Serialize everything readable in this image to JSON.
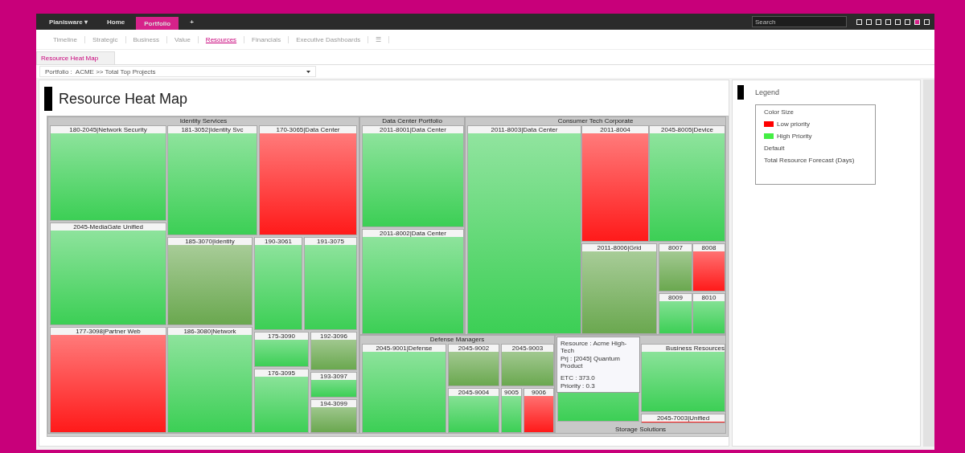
{
  "topbar": {
    "menus": [
      {
        "label": "Planisware ▾",
        "selected": false
      },
      {
        "label": "Home",
        "selected": false
      },
      {
        "label": "Portfolio",
        "selected": true
      },
      {
        "label": "+",
        "selected": false
      }
    ],
    "search": {
      "placeholder": "Search"
    }
  },
  "nav": [
    {
      "label": "Timeline",
      "selected": false
    },
    {
      "label": "Strategic",
      "selected": false
    },
    {
      "label": "Business",
      "selected": false
    },
    {
      "label": "Value",
      "selected": false
    },
    {
      "label": "Resources",
      "selected": true
    },
    {
      "label": "Financials",
      "selected": false
    },
    {
      "label": "Executive Dashboards",
      "selected": false
    },
    {
      "label": "☰",
      "selected": false
    }
  ],
  "subtab": {
    "label": "Resource Heat Map",
    "selected": true
  },
  "filter": {
    "label": "Portfolio :",
    "value": "ACME >> Total Top Projects"
  },
  "heatmap": {
    "title": "Resource Heat Map",
    "groups": [
      {
        "title": "Identity Services",
        "tiles": [
          {
            "label": "180-2045|Network Security",
            "color": "#3ccf55"
          },
          {
            "label": "181-3052|Identity Svc",
            "color": "#3ccf55"
          },
          {
            "label": "170-3065|Data Center",
            "color": "#ff1a1a"
          },
          {
            "label": "2045-MediaGate Unified",
            "color": "#3ccf55"
          },
          {
            "label": "185-3070|Identity",
            "color": "#6aa84f"
          },
          {
            "label": "190-3061",
            "color": "#3ccf55"
          },
          {
            "label": "191-3075",
            "color": "#3ccf55"
          },
          {
            "label": "177-3098|Partner Web",
            "color": "#ff1a1a"
          },
          {
            "label": "186-3080|Network",
            "color": "#3ccf55"
          },
          {
            "label": "175-3090",
            "color": "#3ccf55"
          },
          {
            "label": "176-3095",
            "color": "#3ccf55"
          },
          {
            "label": "192-3096",
            "color": "#6aa84f"
          },
          {
            "label": "193-3097",
            "color": "#3ccf55"
          },
          {
            "label": "194-3099",
            "color": "#6aa84f"
          }
        ]
      },
      {
        "title": "Data Center Portfolio",
        "tiles": [
          {
            "label": "2011-8001|Data Center",
            "color": "#3ccf55"
          },
          {
            "label": "2011-8002|Data Center",
            "color": "#3ccf55"
          }
        ]
      },
      {
        "title": "Consumer Tech Corporate",
        "tiles": [
          {
            "label": "2011-8003|Data Center",
            "color": "#3ccf55"
          },
          {
            "label": "2011-8004",
            "color": "#ff1a1a"
          },
          {
            "label": "2045-8005|Device",
            "color": "#3ccf55"
          },
          {
            "label": "2011-8006|Grid",
            "color": "#6aa84f"
          },
          {
            "label": "8007",
            "color": "#6aa84f"
          },
          {
            "label": "8008",
            "color": "#ff1a1a"
          },
          {
            "label": "8009",
            "color": "#3ccf55"
          },
          {
            "label": "8010",
            "color": "#3ccf55"
          }
        ]
      },
      {
        "title": "Defense Managers",
        "tiles": [
          {
            "label": "2045-9001|Defense",
            "color": "#3ccf55"
          },
          {
            "label": "2045-9002",
            "color": "#6aa84f"
          },
          {
            "label": "2045-9003",
            "color": "#6aa84f"
          },
          {
            "label": "2045-9004",
            "color": "#3ccf55"
          },
          {
            "label": "9005",
            "color": "#3ccf55"
          },
          {
            "label": "9006",
            "color": "#ff1a1a"
          }
        ]
      },
      {
        "title": "Storage Solutions",
        "tiles": [
          {
            "color": "#3ccf55"
          },
          {
            "label": "Business Resources",
            "color": "#3ccf55"
          },
          {
            "label": "2045-7003|Unified",
            "color": "#ff1a1a"
          }
        ]
      }
    ],
    "tooltip": [
      "Resource : Acme High-Tech",
      "Prj : [2045] Quantum Product",
      "ETC : 373.0",
      "Priority : 0.3"
    ]
  },
  "legend": {
    "title": "Legend",
    "heading": "Color Size",
    "items": [
      {
        "kind": "swatch",
        "label": "Low priority",
        "color": "#ff0000"
      },
      {
        "kind": "swatch",
        "label": "High Priority",
        "color": "#44ee44"
      },
      {
        "kind": "text",
        "label": "Default"
      },
      {
        "kind": "text",
        "label": "Total Resource Forecast (Days)"
      }
    ]
  }
}
